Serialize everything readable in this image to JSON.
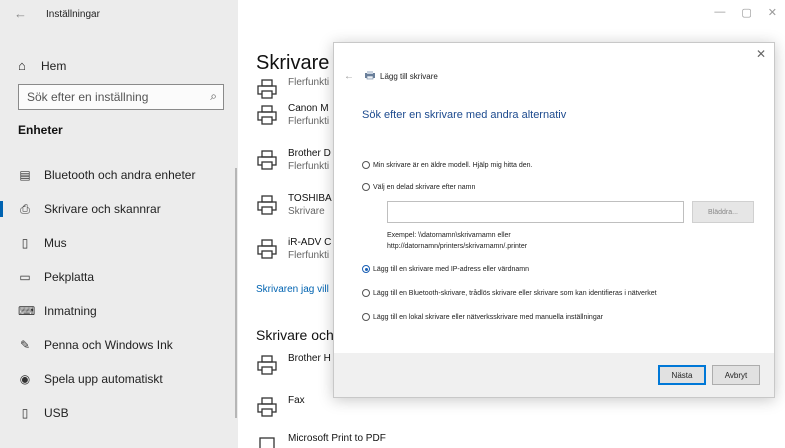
{
  "window": {
    "title": "Inställningar",
    "controls": [
      "—",
      "▢",
      "✕"
    ]
  },
  "sidebar": {
    "home_label": "Hem",
    "search_placeholder": "Sök efter en inställning",
    "section": "Enheter",
    "items": [
      {
        "label": "Bluetooth och andra enheter",
        "icon": "bluetooth-devices-icon"
      },
      {
        "label": "Skrivare och skannrar",
        "icon": "printer-icon",
        "selected": true
      },
      {
        "label": "Mus",
        "icon": "mouse-icon"
      },
      {
        "label": "Pekplatta",
        "icon": "touchpad-icon"
      },
      {
        "label": "Inmatning",
        "icon": "keyboard-icon"
      },
      {
        "label": "Penna och Windows Ink",
        "icon": "pen-icon"
      },
      {
        "label": "Spela upp automatiskt",
        "icon": "autoplay-icon"
      },
      {
        "label": "USB",
        "icon": "usb-icon"
      }
    ]
  },
  "main": {
    "title": "Skrivare c",
    "printers": [
      {
        "name": "",
        "sub": "Flerfunkti"
      },
      {
        "name": "Canon M",
        "sub": "Flerfunkti"
      },
      {
        "name": "Brother D",
        "sub": "Flerfunkti"
      },
      {
        "name": "TOSHIBA",
        "sub": "Skrivare"
      },
      {
        "name": "iR-ADV C",
        "sub": "Flerfunkti"
      }
    ],
    "link": "Skrivaren jag vill",
    "subtitle": "Skrivare och",
    "other_printers": [
      {
        "name": "Brother H"
      },
      {
        "name": "Fax"
      },
      {
        "name": "Microsoft Print to PDF"
      }
    ]
  },
  "dialog": {
    "title": "Lägg till skrivare",
    "heading": "Sök efter en skrivare med andra alternativ",
    "options": [
      {
        "label": "Min skrivare är en äldre modell. Hjälp mig hitta den.",
        "checked": false
      },
      {
        "label": "Välj en delad skrivare efter namn",
        "checked": false
      },
      {
        "label": "Lägg till en skrivare med IP-adress eller värdnamn",
        "checked": true
      },
      {
        "label": "Lägg till en Bluetooth-skrivare, trådlös skrivare eller skrivare som kan identifieras i nätverket",
        "checked": false
      },
      {
        "label": "Lägg till en lokal skrivare eller nätverksskrivare med manuella inställningar",
        "checked": false
      }
    ],
    "shared_value": "",
    "browse_label": "Bläddra...",
    "example_line1": "Exempel: \\\\datornamn\\skrivarnamn eller",
    "example_line2": "http://datornamn/printers/skrivarnamn/.printer",
    "next_label": "Nästa",
    "cancel_label": "Avbryt"
  }
}
